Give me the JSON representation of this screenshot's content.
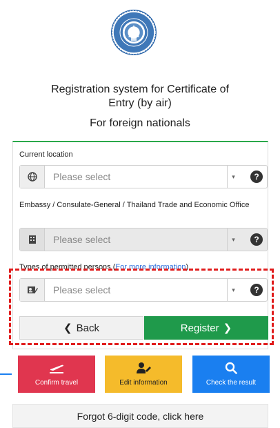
{
  "header": {
    "title_line1": "Registration system for Certificate of",
    "title_line2": "Entry (by air)",
    "subtitle": "For foreign nationals"
  },
  "form": {
    "current_location": {
      "label": "Current location",
      "placeholder": "Please select",
      "icon": "globe-icon"
    },
    "embassy": {
      "label": "Embassy / Consulate-General / Thailand Trade and Economic Office",
      "placeholder": "Please select",
      "icon": "building-icon",
      "disabled": true
    },
    "permitted_types": {
      "label_prefix": "Types of permitted persons (",
      "label_link": "For more information",
      "label_suffix": ")",
      "placeholder": "Please select",
      "icon": "id-card-icon"
    },
    "help_glyph": "?",
    "caret_glyph": "▾"
  },
  "buttons": {
    "back": "Back",
    "register": "Register"
  },
  "tiles": [
    {
      "label": "Confirm travel",
      "icon": "plane-icon",
      "color": "#e0364f"
    },
    {
      "label": "Edit information",
      "icon": "user-edit-icon",
      "color": "#f5bb2b"
    },
    {
      "label": "Check the result",
      "icon": "search-icon",
      "color": "#1a7ff0"
    }
  ],
  "footer": {
    "forgot": "Forgot 6-digit code, click here"
  },
  "colors": {
    "accent_green": "#1f9a4b",
    "highlight_red": "#e01b1b",
    "link_blue": "#2f6fdb"
  }
}
